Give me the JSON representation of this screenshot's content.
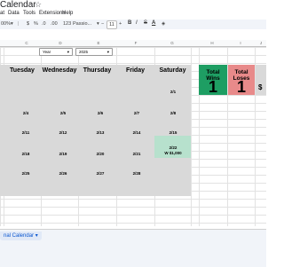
{
  "app": {
    "title": "Calendar",
    "star_icon": "star-icon"
  },
  "menu": [
    "at",
    "Data",
    "Tools",
    "Extensions",
    "Help"
  ],
  "toolbar": {
    "zoom": "00%",
    "font": "Passio...",
    "font_size": "11",
    "bold": "B",
    "italic": "I",
    "strike": "S",
    "text_color": "A"
  },
  "columns": [
    "C",
    "D",
    "E",
    "F",
    "G",
    "H",
    "I",
    "J",
    "K"
  ],
  "selectors": {
    "year_label": "Year",
    "year_value": "2025"
  },
  "calendar": {
    "day_headers": [
      "Tuesday",
      "Wednesday",
      "Thursday",
      "Friday",
      "Saturday"
    ],
    "dates": {
      "row1": [
        "",
        "",
        "",
        "",
        "2/1"
      ],
      "row2": [
        "2/4",
        "2/5",
        "2/6",
        "2/7",
        "2/8"
      ],
      "row3": [
        "2/11",
        "2/12",
        "2/13",
        "2/14",
        "2/15"
      ],
      "row4": [
        "2/18",
        "2/19",
        "2/20",
        "2/21",
        "2/22"
      ],
      "row5": [
        "2/25",
        "2/26",
        "2/27",
        "2/28",
        ""
      ]
    },
    "highlight_note": "W $1,000",
    "colors": {
      "background": "#d9d9d9",
      "win_highlight": "#b7e1cd"
    }
  },
  "stats": {
    "total_wins_label": "Total Wins",
    "total_wins_value": "1",
    "total_losses_label": "Total Loses",
    "total_losses_value": "1",
    "partial_value": "$",
    "colors": {
      "wins": "#1e9e63",
      "losses": "#e88a8a"
    }
  },
  "sheet_tab": {
    "label": "nal Calendar"
  }
}
